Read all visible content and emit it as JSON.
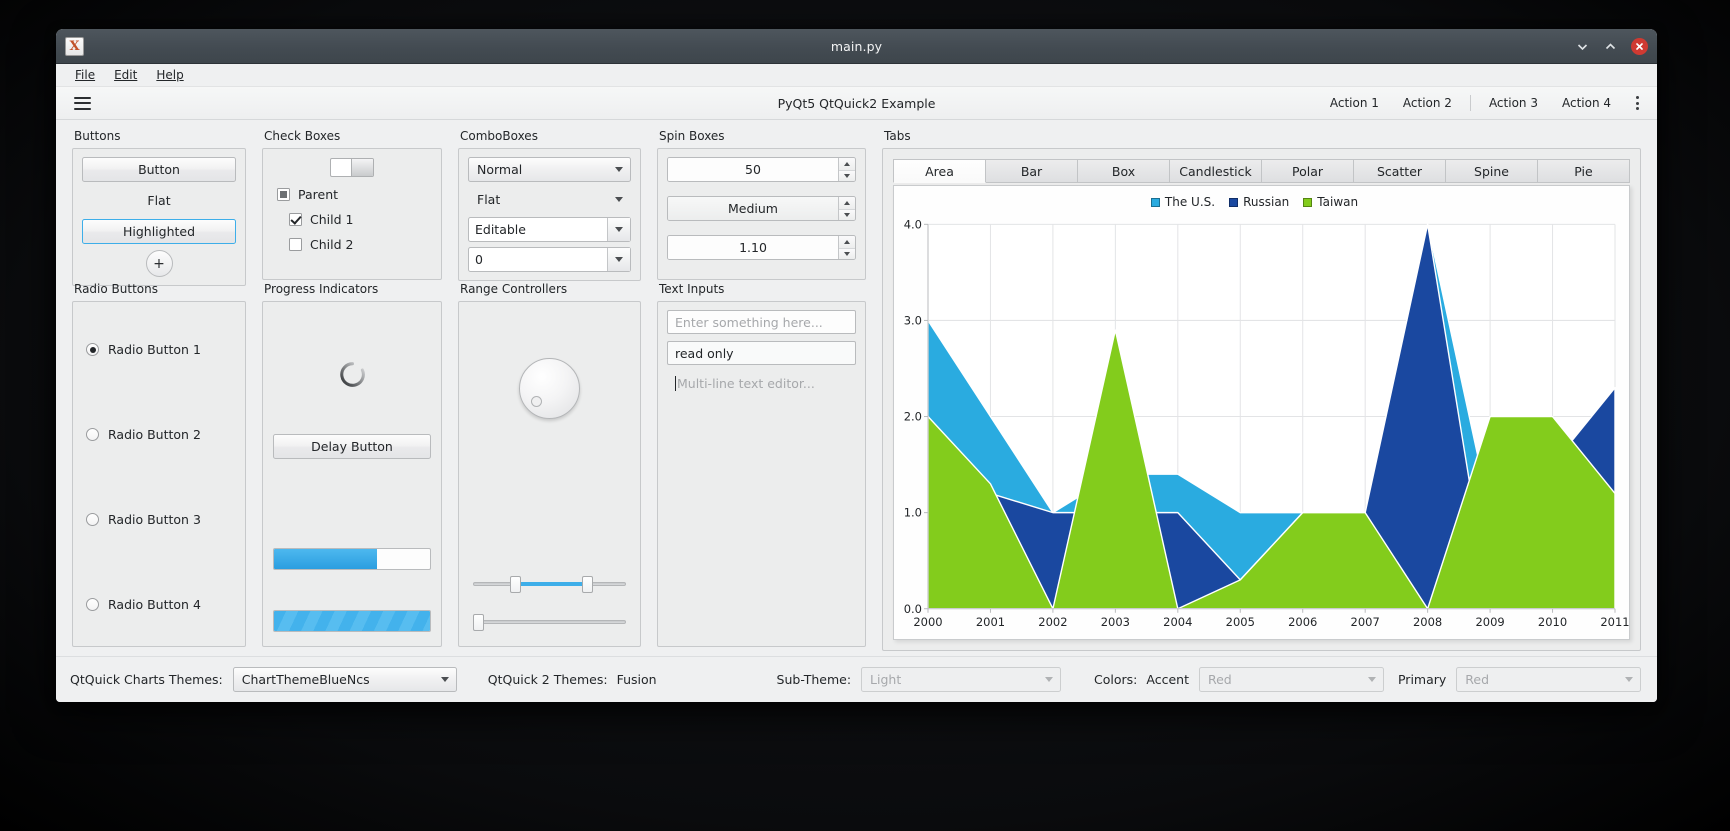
{
  "window": {
    "title": "main.py",
    "icon": "x-app-icon",
    "controls": {
      "minimize": "minimize",
      "maximize": "maximize",
      "close": "close"
    }
  },
  "menubar": {
    "items": [
      "File",
      "Edit",
      "Help"
    ]
  },
  "toolbar": {
    "menu_icon": "hamburger-icon",
    "title": "PyQt5 QtQuick2 Example",
    "actions": [
      "Action 1",
      "Action 2",
      "Action 3",
      "Action 4"
    ],
    "overflow_icon": "kebab-menu-icon"
  },
  "groups": {
    "buttons": {
      "title": "Buttons",
      "normal": "Button",
      "flat": "Flat",
      "highlighted": "Highlighted",
      "round": "+"
    },
    "checkboxes": {
      "title": "Check Boxes",
      "switch_state": "on",
      "parent": {
        "label": "Parent",
        "state": "partial"
      },
      "child1": {
        "label": "Child 1",
        "state": "checked"
      },
      "child2": {
        "label": "Child 2",
        "state": "unchecked"
      }
    },
    "comboboxes": {
      "title": "ComboBoxes",
      "normal": "Normal",
      "flat": "Flat",
      "editable": "Editable",
      "numeric": "0"
    },
    "spinboxes": {
      "title": "Spin Boxes",
      "value1": "50",
      "value2": "Medium",
      "value3": "1.10"
    },
    "radiobuttons": {
      "title": "Radio Buttons",
      "items": [
        {
          "label": "Radio Button 1",
          "selected": true
        },
        {
          "label": "Radio Button 2",
          "selected": false
        },
        {
          "label": "Radio Button 3",
          "selected": false
        },
        {
          "label": "Radio Button 4",
          "selected": false
        }
      ]
    },
    "progress": {
      "title": "Progress Indicators",
      "busy_icon": "busy-spinner-icon",
      "delay_button": "Delay Button",
      "bar_percent": 66,
      "indeterminate": true
    },
    "range": {
      "title": "Range Controllers",
      "dial_icon": "dial-knob",
      "slider1_percent": 28,
      "slider1_second_percent": 75,
      "slider2_percent": 2
    },
    "textinputs": {
      "title": "Text Inputs",
      "field1_placeholder": "Enter something here...",
      "field1_value": "",
      "field2_value": "read only",
      "textarea_placeholder": "Multi-line text editor..."
    },
    "tabs": {
      "title": "Tabs",
      "items": [
        "Area",
        "Bar",
        "Box",
        "Candlestick",
        "Polar",
        "Scatter",
        "Spine",
        "Pie"
      ],
      "active": "Area"
    }
  },
  "chart_data": {
    "type": "area",
    "title": "",
    "xlabel": "",
    "ylabel": "",
    "categories": [
      "2000",
      "2001",
      "2002",
      "2003",
      "2004",
      "2005",
      "2006",
      "2007",
      "2008",
      "2009",
      "2010",
      "2011"
    ],
    "x": [
      2000,
      2001,
      2002,
      2003,
      2004,
      2005,
      2006,
      2007,
      2008,
      2009,
      2010,
      2011
    ],
    "xlim": [
      2000,
      2011
    ],
    "ylim": [
      0,
      4
    ],
    "yticks": [
      "0.0",
      "1.0",
      "2.0",
      "3.0",
      "4.0"
    ],
    "grid": true,
    "legend_position": "top",
    "stacked": false,
    "series": [
      {
        "name": "The U.S.",
        "color": "#2aabe0",
        "values": [
          3.0,
          2.0,
          1.0,
          1.4,
          1.4,
          1.0,
          1.0,
          1.0,
          4.0,
          1.0,
          1.0,
          1.0
        ]
      },
      {
        "name": "Russian",
        "color": "#1a48a0",
        "values": [
          2.0,
          1.2,
          1.0,
          1.0,
          1.0,
          0.3,
          1.0,
          1.0,
          4.0,
          0.0,
          1.5,
          2.3
        ]
      },
      {
        "name": "Taiwan",
        "color": "#83cc1c",
        "values": [
          2.0,
          1.3,
          0.0,
          2.9,
          0.0,
          0.3,
          1.0,
          1.0,
          0.0,
          2.0,
          2.0,
          1.2
        ]
      }
    ]
  },
  "bottombar": {
    "charts_themes_label": "QtQuick Charts Themes:",
    "charts_theme_value": "ChartThemeBlueNcs",
    "qtquick_themes_label": "QtQuick 2 Themes:",
    "qtquick_theme_value": "Fusion",
    "subtheme_label": "Sub-Theme:",
    "subtheme_value": "Light",
    "colors_label": "Colors:",
    "accent_label": "Accent",
    "accent_value": "Red",
    "primary_label": "Primary",
    "primary_value": "Red"
  }
}
